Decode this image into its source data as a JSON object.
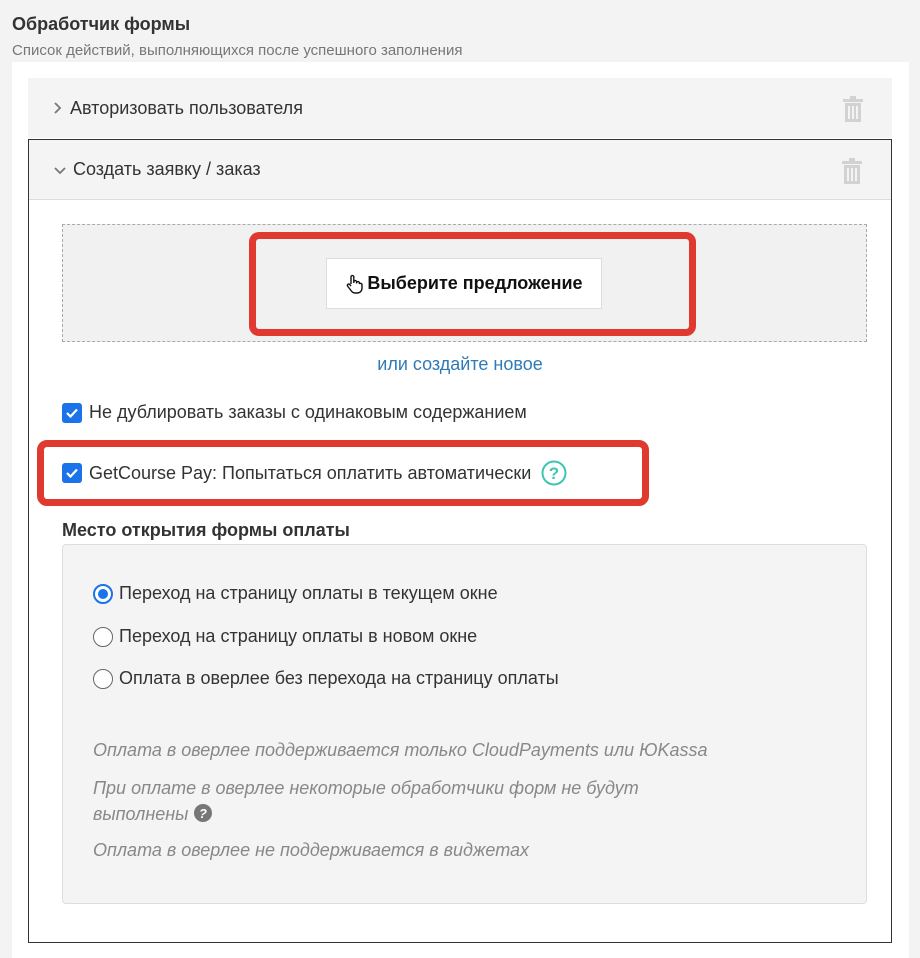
{
  "header": {
    "title": "Обработчик формы",
    "subtitle": "Список действий, выполняющихся после успешного заполнения"
  },
  "accordion": {
    "item1": {
      "label": "Авторизовать пользователя",
      "expanded": false
    },
    "item2": {
      "label": "Создать заявку / заказ",
      "expanded": true
    }
  },
  "offer": {
    "select_button": "Выберите предложение",
    "create_link": "или создайте новое"
  },
  "checkboxes": {
    "no_duplicates": {
      "label": "Не дублировать заказы с одинаковым содержанием",
      "checked": true
    },
    "auto_pay": {
      "label": "GetCourse Pay: Попытаться оплатить автоматически",
      "checked": true
    }
  },
  "payment_place": {
    "title": "Место открытия формы оплаты",
    "options": [
      {
        "label": "Переход на страницу оплаты в текущем окне",
        "selected": true
      },
      {
        "label": "Переход на страницу оплаты в новом окне",
        "selected": false
      },
      {
        "label": "Оплата в оверлее без перехода на страницу оплаты",
        "selected": false
      }
    ],
    "notes": [
      "Оплата в оверлее поддерживается только CloudPayments или ЮKassa",
      "При оплате в оверлее некоторые обработчики форм не будут выполнены",
      "Оплата в оверлее не поддерживается в виджетах"
    ]
  },
  "colors": {
    "highlight": "#e03a30",
    "accent": "#1a73e8",
    "link": "#2e7ab8",
    "help_green": "#3cc6b0"
  },
  "icons": {
    "collapsed": "chevron-right-icon",
    "expanded": "chevron-down-icon",
    "delete": "trash-icon",
    "pointer": "hand-pointer-icon",
    "help": "question-icon"
  }
}
